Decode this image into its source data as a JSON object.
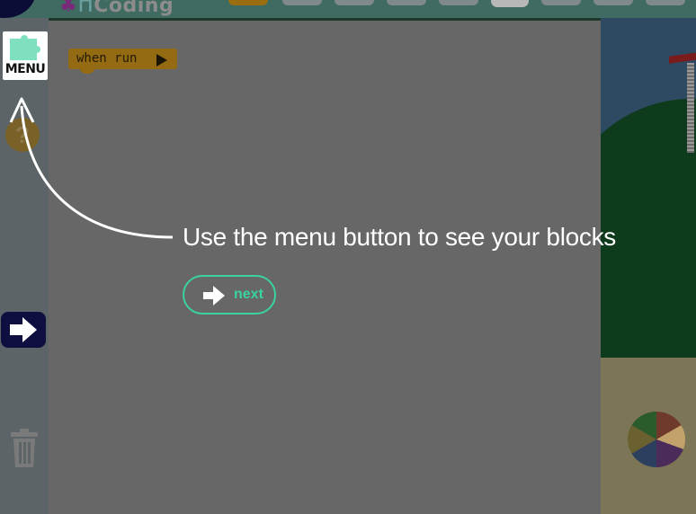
{
  "header": {
    "brand": "Coding",
    "tabs": [
      "tab1",
      "tab2",
      "tab3",
      "tab4",
      "tab5",
      "tab6",
      "tab7",
      "tab8"
    ]
  },
  "toolbar": {
    "menu_label": "MENU",
    "menu_icon": "puzzle-icon",
    "help_icon": "question-icon",
    "run_icon": "arrow-right-icon",
    "trash_icon": "trash-icon"
  },
  "workspace": {
    "block_label": "when run"
  },
  "tutorial": {
    "caption": "Use the menu button to see your blocks",
    "next_label": "next"
  },
  "colors": {
    "accent": "#3ad39b",
    "run_button": "#0e0f40",
    "block": "#946b12",
    "puzzle": "#7fe0c0"
  }
}
